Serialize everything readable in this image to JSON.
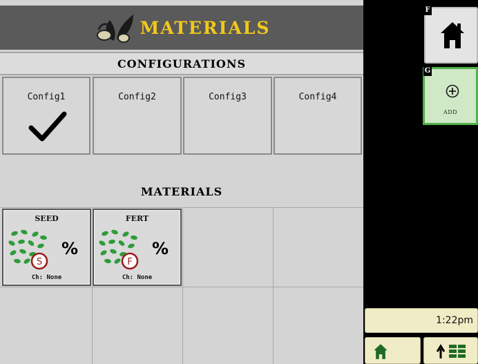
{
  "header": {
    "title": "MATERIALS",
    "icon": "seed-leaf-icon"
  },
  "configurations": {
    "heading": "CONFIGURATIONS",
    "items": [
      {
        "label": "Config1",
        "selected": true
      },
      {
        "label": "Config2",
        "selected": false
      },
      {
        "label": "Config3",
        "selected": false
      },
      {
        "label": "Config4",
        "selected": false
      }
    ]
  },
  "materials": {
    "heading": "MATERIALS",
    "items": [
      {
        "name": "SEED",
        "badge": "S",
        "unit": "%",
        "channel": "Ch: None"
      },
      {
        "name": "FERT",
        "badge": "F",
        "unit": "%",
        "channel": "Ch: None"
      }
    ]
  },
  "softkeys": {
    "home": {
      "letter": "F",
      "icon": "home-icon"
    },
    "add": {
      "letter": "G",
      "label": "ADD",
      "icon": "plus-circle-icon"
    }
  },
  "status": {
    "time": "1:22pm"
  },
  "bottom_bar": {
    "home_icon": "home-icon",
    "layout_icon": "up-arrow-grid-icon"
  },
  "colors": {
    "title_bg": "#5a5a5a",
    "title_text": "#f2c81a",
    "add_border": "#4fb04a",
    "badge": "#9a1b1b",
    "bean": "#2e9c3a"
  }
}
